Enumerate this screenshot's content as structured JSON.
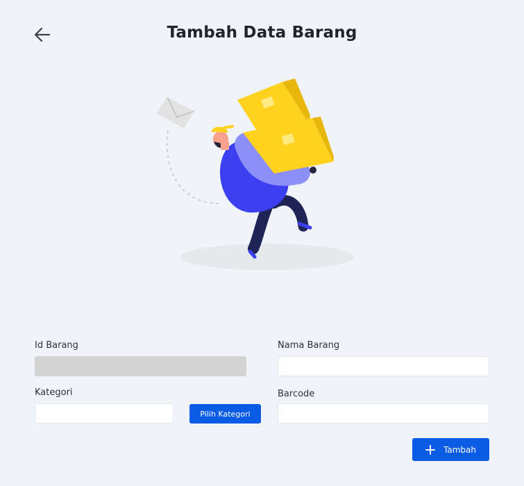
{
  "header": {
    "back_icon": "arrow-left-icon",
    "title": "Tambah Data Barang"
  },
  "illustration": {
    "name": "delivery-man-carrying-boxes",
    "colors": {
      "box": "#ffd21f",
      "shirt": "#3b3ff0",
      "pants": "#1f2457",
      "envelope": "#e4e4e4"
    }
  },
  "form": {
    "id_barang": {
      "label": "Id Barang",
      "value": "",
      "disabled": true
    },
    "kategori": {
      "label": "Kategori",
      "value": "",
      "button_label": "Pilih Kategori"
    },
    "nama_barang": {
      "label": "Nama Barang",
      "value": ""
    },
    "barcode": {
      "label": "Barcode",
      "value": ""
    },
    "submit": {
      "label": "Tambah",
      "icon": "plus-icon"
    }
  },
  "colors": {
    "background": "#f0f4f9",
    "accent": "#0a5ce6",
    "disabled_input": "#d3d3d3"
  }
}
